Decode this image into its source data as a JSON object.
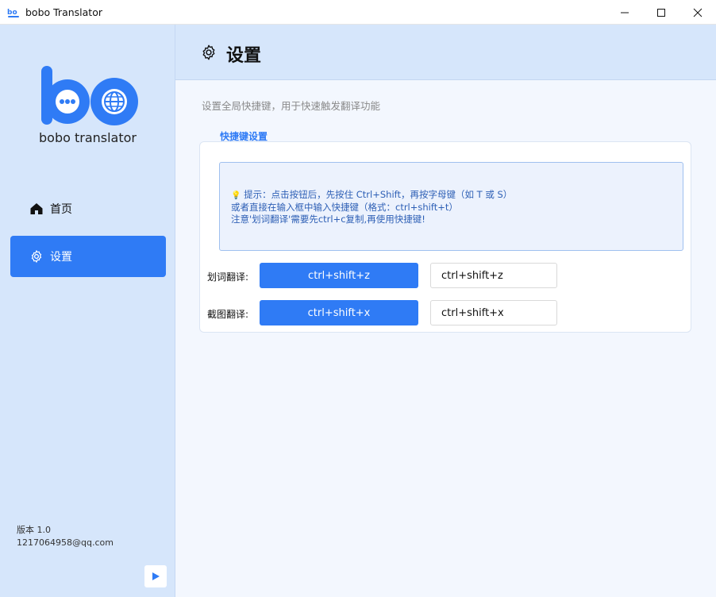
{
  "window": {
    "title": "bobo Translator",
    "icon": "bobo-app-icon",
    "controls": [
      "minimize-icon",
      "maximize-icon",
      "close-icon"
    ]
  },
  "sidebar": {
    "logo_text": "bobo translator",
    "items": [
      {
        "label": "首页",
        "icon": "home-icon",
        "active": false
      },
      {
        "label": "设置",
        "icon": "gear-icon",
        "active": true
      }
    ],
    "version": "版本 1.0",
    "email": "1217064958@qq.com",
    "play_icon": "play-icon"
  },
  "header": {
    "title": "设置",
    "icon": "gear-icon"
  },
  "main": {
    "description": "设置全局快捷键，用于快速触发翻译功能",
    "section_label": "快捷键设置",
    "tip": {
      "icon": "💡",
      "line1": "提示：点击按钮后，先按住 Ctrl+Shift，再按字母键（如 T 或 S）",
      "line2": "或者直接在输入框中输入快捷键（格式：ctrl+shift+t）",
      "line3": "注意'划词翻译'需要先ctrl+c复制,再使用快捷键!"
    },
    "hotkeys": [
      {
        "label": "划词翻译:",
        "button": "ctrl+shift+z",
        "value": "ctrl+shift+z"
      },
      {
        "label": "截图翻译:",
        "button": "ctrl+shift+x",
        "value": "ctrl+shift+x"
      }
    ]
  },
  "colors": {
    "accent": "#2f7bf5",
    "sidebar_bg": "#d6e6fb",
    "content_bg": "#f3f7fe"
  }
}
